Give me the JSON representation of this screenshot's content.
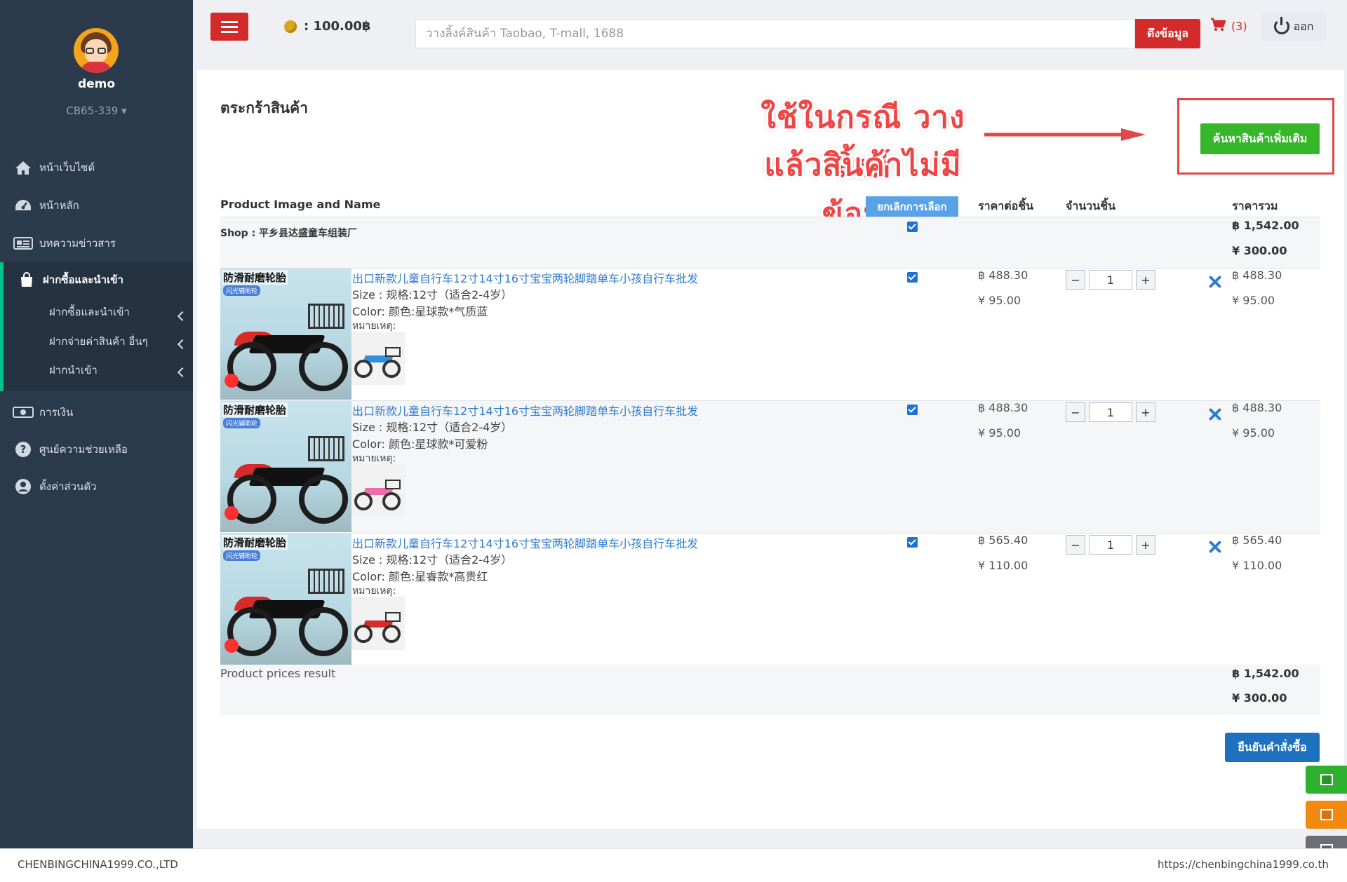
{
  "user": {
    "name": "demo",
    "code": "CB65-339"
  },
  "sidebar": {
    "items": [
      {
        "label": "หน้าเว็บไซต์",
        "icon": "home-icon"
      },
      {
        "label": "หน้าหลัก",
        "icon": "dashboard-icon"
      },
      {
        "label": "บทความข่าวสาร",
        "icon": "newspaper-icon"
      },
      {
        "label": "ฝากซื้อและนำเข้า",
        "icon": "shopping-bag-icon"
      },
      {
        "label": "การเงิน",
        "icon": "money-icon"
      },
      {
        "label": "ศูนย์ความช่วยเหลือ",
        "icon": "question-icon"
      },
      {
        "label": "ตั้งค่าส่วนตัว",
        "icon": "user-icon"
      }
    ],
    "subitems": [
      {
        "label": "ฝากซื้อและนำเข้า"
      },
      {
        "label": "ฝากจ่ายค่าสินค้า อื่นๆ"
      },
      {
        "label": "ฝากนำเข้า"
      }
    ]
  },
  "topbar": {
    "balance": ": 100.00฿",
    "search_placeholder": "วางลิ้งค์สินค้า Taobao, T-mall, 1688",
    "fetch_label": "ดึงข้อมูล",
    "cart_count": "(3)",
    "logout_label": "ออก"
  },
  "page": {
    "title": "ตระกร้าสินค้า",
    "annotation_line1": "ใช้ในกรณี วางลิ้งค์",
    "annotation_line2": "แล้วสินค้าไม่มีข้อมูล",
    "more_button": "ค้นหาสินค้าเพิ่มเติม"
  },
  "table": {
    "headers": {
      "product": "Product Image and Name",
      "cancel_select": "ยกเลิกการเลือก",
      "unit_price": "ราคาต่อชิ้น",
      "qty": "จำนวนชิ้น",
      "total": "ราคารวม"
    },
    "shop": {
      "label": "Shop : 平乡县达盛童车组装厂",
      "total_thb": "฿ 1,542.00",
      "total_cny": "¥ 300.00"
    },
    "items": [
      {
        "badge": "防滑耐磨轮胎",
        "badge2": "闪光辅助轮",
        "title": "出口新款儿童自行车12寸14寸16寸宝宝两轮脚踏单车小孩自行车批发",
        "size": "Size : 规格:12寸（适合2-4岁）",
        "color": "Color: 颜色:星球款*气质蓝",
        "note": "หมายเหตุ:",
        "thumb_color": "#2f8fe0",
        "unit_thb": "฿ 488.30",
        "unit_cny": "¥ 95.00",
        "qty": "1",
        "total_thb": "฿ 488.30",
        "total_cny": "¥ 95.00"
      },
      {
        "badge": "防滑耐磨轮胎",
        "badge2": "闪光辅助轮",
        "title": "出口新款儿童自行车12寸14寸16寸宝宝两轮脚踏单车小孩自行车批发",
        "size": "Size : 规格:12寸（适合2-4岁）",
        "color": "Color: 颜色:星球款*可爱粉",
        "note": "หมายเหตุ:",
        "thumb_color": "#ee6fa8",
        "unit_thb": "฿ 488.30",
        "unit_cny": "¥ 95.00",
        "qty": "1",
        "total_thb": "฿ 488.30",
        "total_cny": "¥ 95.00"
      },
      {
        "badge": "防滑耐磨轮胎",
        "badge2": "闪光辅助轮",
        "title": "出口新款儿童自行车12寸14寸16寸宝宝两轮脚踏单车小孩自行车批发",
        "size": "Size : 规格:12寸（适合2-4岁）",
        "color": "Color: 颜色:星睿款*高贵红",
        "note": "หมายเหตุ:",
        "thumb_color": "#d72b2b",
        "unit_thb": "฿ 565.40",
        "unit_cny": "¥ 110.00",
        "qty": "1",
        "total_thb": "฿ 565.40",
        "total_cny": "¥ 110.00"
      }
    ],
    "summary": {
      "label": "Product prices result",
      "total_thb": "฿ 1,542.00",
      "total_cny": "¥ 300.00"
    }
  },
  "confirm_label": "ยืนยันคำสั่งซื้อ",
  "qty_minus": "−",
  "qty_plus": "+",
  "colors": {
    "sidebar": "#2c3b4c",
    "accent_red": "#d32b2b",
    "accent_green": "#35b729",
    "accent_blue": "#1d71bf",
    "float_green": "#2eb12e",
    "float_orange": "#f28a12",
    "float_gray": "#6b6f75"
  },
  "footer": {
    "left": "CHENBINGCHINA1999.CO.,LTD",
    "right": "https://chenbingchina1999.co.th"
  }
}
